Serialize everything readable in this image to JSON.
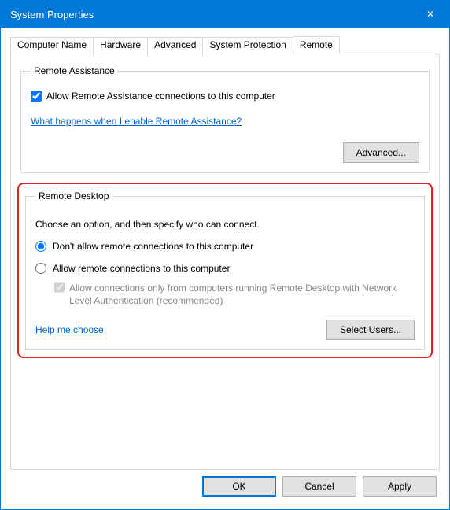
{
  "window": {
    "title": "System Properties",
    "close": "✕"
  },
  "tabs": {
    "t0": "Computer Name",
    "t1": "Hardware",
    "t2": "Advanced",
    "t3": "System Protection",
    "t4": "Remote",
    "active": "t4"
  },
  "remote_assistance": {
    "legend": "Remote Assistance",
    "allow_label": "Allow Remote Assistance connections to this computer",
    "allow_checked": true,
    "help_link": "What happens when I enable Remote Assistance?",
    "advanced_btn": "Advanced..."
  },
  "remote_desktop": {
    "legend": "Remote Desktop",
    "instruction": "Choose an option, and then specify who can connect.",
    "opt_dont_allow": "Don't allow remote connections to this computer",
    "opt_allow": "Allow remote connections to this computer",
    "selected": "dont_allow",
    "nla_label": "Allow connections only from computers running Remote Desktop with Network Level Authentication (recommended)",
    "nla_checked": true,
    "nla_enabled": false,
    "help_link": "Help me choose",
    "select_users_btn": "Select Users..."
  },
  "buttons": {
    "ok": "OK",
    "cancel": "Cancel",
    "apply": "Apply"
  }
}
